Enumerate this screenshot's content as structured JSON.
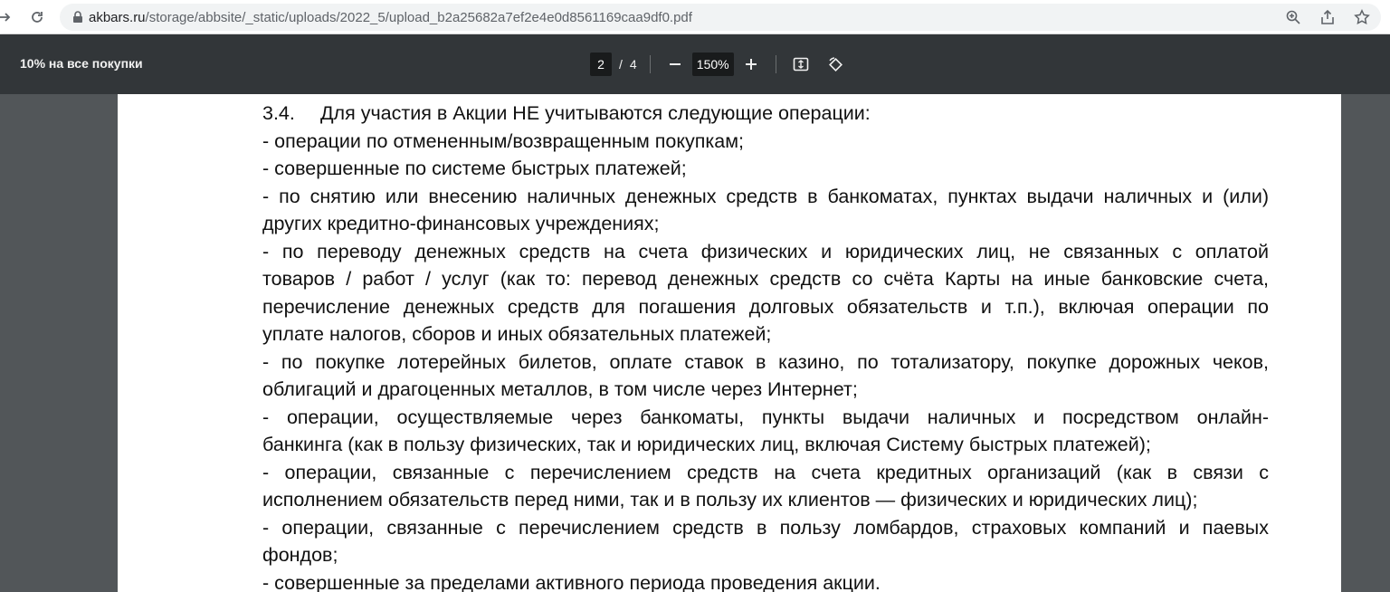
{
  "browser": {
    "url_host": "akbars.ru",
    "url_path": "/storage/abbsite/_static/uploads/2022_5/upload_b2a25682a7ef2e4e0d8561169caa9df0.pdf"
  },
  "pdf_toolbar": {
    "title": "10% на все покупки",
    "current_page": "2",
    "separator": "/",
    "total_pages": "4",
    "zoom": "150%",
    "zoom_out_label": "—",
    "zoom_in_label": "+"
  },
  "document": {
    "heading_number": "3.4.",
    "heading_text": "Для участия в Акции НЕ учитываются следующие операции:",
    "lines": [
      "- операции по отмененным/возвращенным покупкам;",
      "- совершенные по системе быстрых платежей;",
      "- по снятию или внесению наличных денежных средств в банкоматах, пунктах выдачи наличных и (или)",
      "других кредитно-финансовых учреждениях;",
      "- по переводу денежных средств на счета физических и юридических лиц, не связанных с оплатой",
      "товаров / работ / услуг (как то: перевод денежных средств со счёта Карты на иные банковские счета,",
      "перечисление денежных средств для погашения долговых обязательств и т.п.), включая операции по",
      "уплате налогов, сборов и иных обязательных платежей;",
      "- по покупке лотерейных билетов, оплате ставок в казино, по тотализатору, покупке дорожных чеков,",
      "облигаций и драгоценных металлов, в том числе через Интернет;",
      "- операции, осуществляемые через банкоматы, пункты выдачи наличных и посредством онлайн-",
      "банкинга (как в пользу физических, так и юридических лиц, включая Систему быстрых платежей);",
      "- операции, связанные с перечислением средств на счета кредитных организаций (как в связи с",
      "исполнением обязательств перед ними, так и в пользу их клиентов — физических и юридических лиц);",
      "- операции, связанные с перечислением средств в пользу ломбардов, страховых компаний и паевых",
      "фондов;",
      "- совершенные за пределами активного периода проведения акции."
    ]
  }
}
